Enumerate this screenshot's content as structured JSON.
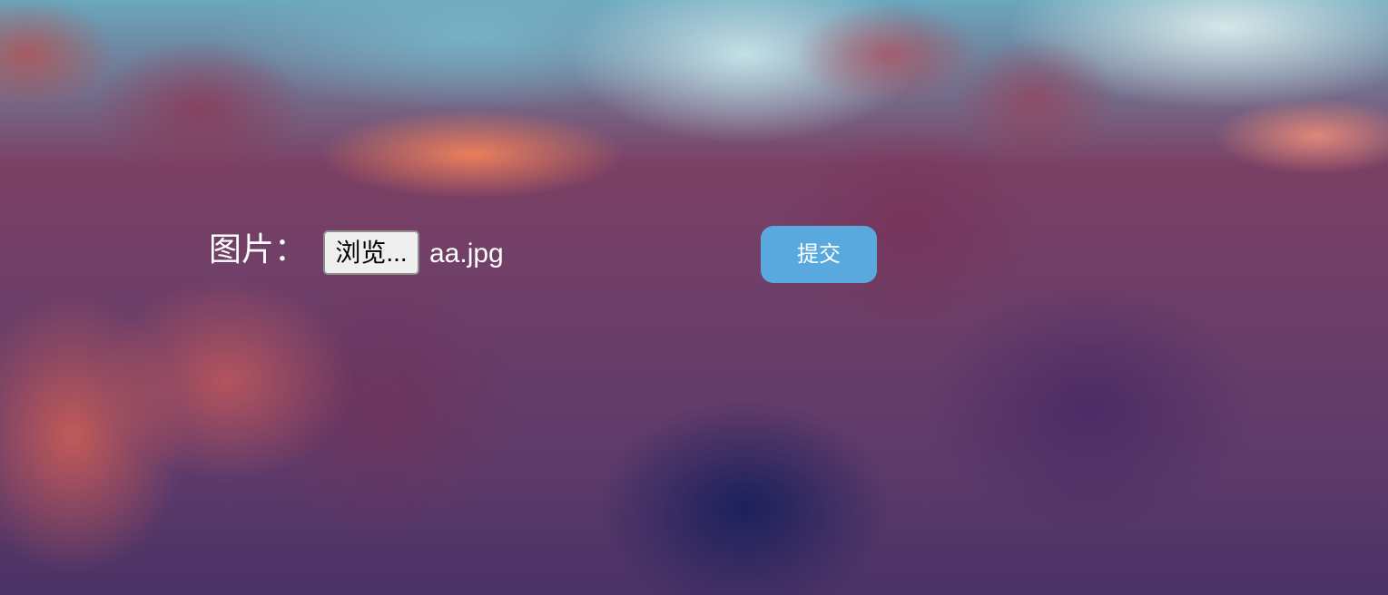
{
  "form": {
    "image_label": "图片：",
    "browse_button_label": "浏览...",
    "selected_file_name": "aa.jpg",
    "submit_button_label": "提交"
  },
  "colors": {
    "submit_button": "#59a9df",
    "label_text": "#ffffff"
  }
}
